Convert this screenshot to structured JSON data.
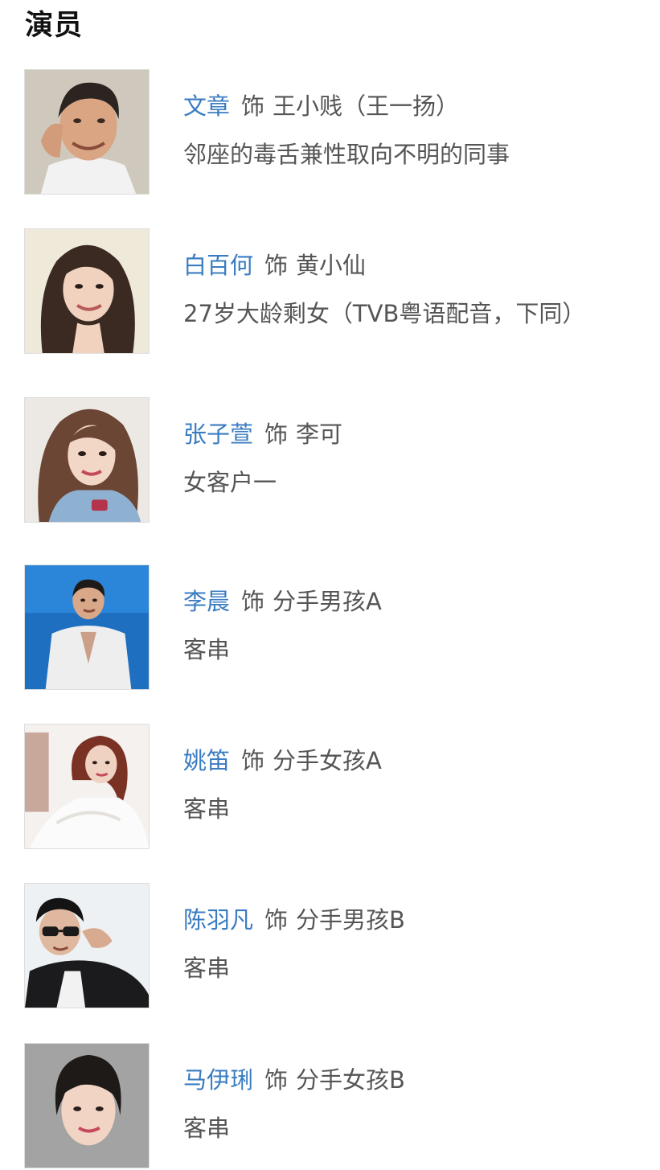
{
  "section": {
    "title": "演员"
  },
  "cast": [
    {
      "actor": "文章",
      "as_label": "饰",
      "role": "王小贱（王一扬）",
      "description": "邻座的毒舌兼性取向不明的同事",
      "photo_icon": "portrait-man-smiling"
    },
    {
      "actor": "白百何",
      "as_label": "饰",
      "role": "黄小仙",
      "description": "27岁大龄剩女（TVB粤语配音，下同）",
      "photo_icon": "portrait-woman-curly-hair"
    },
    {
      "actor": "张子萱",
      "as_label": "饰",
      "role": "李可",
      "description": "女客户一",
      "photo_icon": "portrait-woman-long-hair"
    },
    {
      "actor": "李晨",
      "as_label": "饰",
      "role": "分手男孩A",
      "description": "客串",
      "photo_icon": "portrait-man-blue-background"
    },
    {
      "actor": "姚笛",
      "as_label": "饰",
      "role": "分手女孩A",
      "description": "客串",
      "photo_icon": "portrait-woman-white-dress"
    },
    {
      "actor": "陈羽凡",
      "as_label": "饰",
      "role": "分手男孩B",
      "description": "客串",
      "photo_icon": "portrait-man-sunglasses"
    },
    {
      "actor": "马伊琍",
      "as_label": "饰",
      "role": "分手女孩B",
      "description": "客串",
      "photo_icon": "portrait-woman-short-hair"
    }
  ],
  "colors": {
    "actor_link": "#3a7cc1",
    "body_text": "#555555",
    "title_text": "#111111"
  }
}
